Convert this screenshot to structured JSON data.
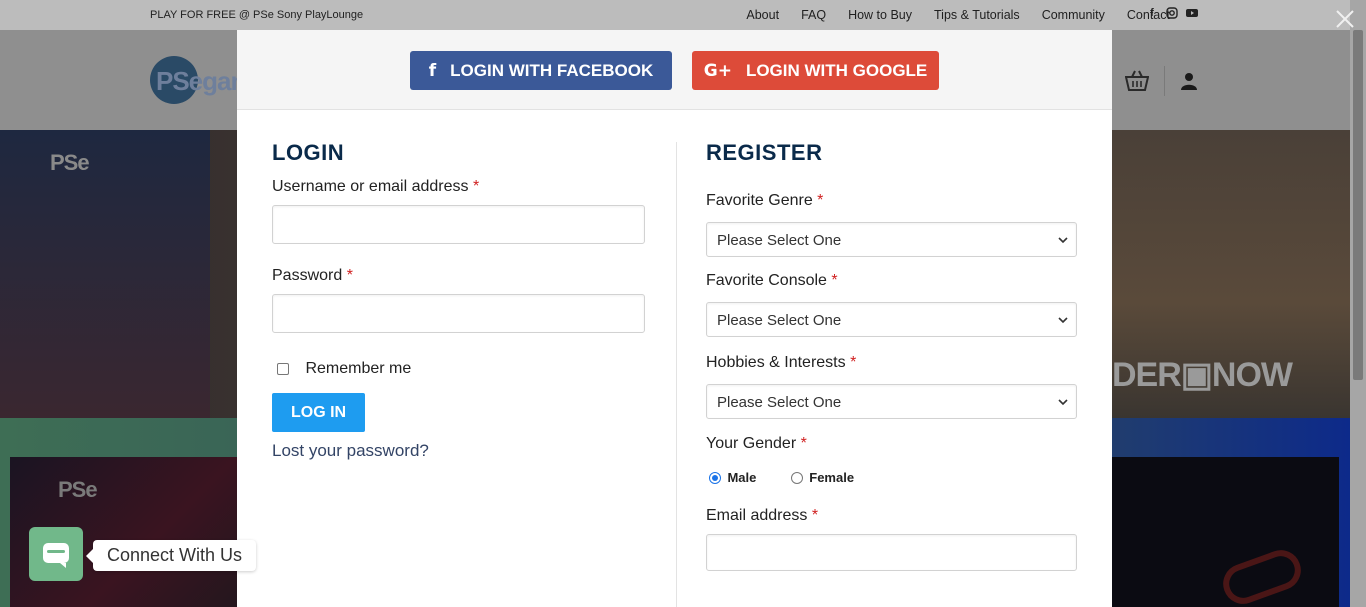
{
  "topbar": {
    "promo": "PLAY FOR FREE @ PSe Sony PlayLounge",
    "nav": [
      "About",
      "FAQ",
      "How to Buy",
      "Tips & Tutorials",
      "Community",
      "Contact"
    ],
    "social_icons": [
      "facebook-icon",
      "instagram-icon",
      "youtube-icon"
    ]
  },
  "header": {
    "logo_text": "PSegam"
  },
  "hero": {
    "left_logo": "PSe",
    "preorder_text": "DER▣NOW",
    "card_logo": "PSe"
  },
  "social_login": {
    "facebook_label": "LOGIN WITH FACEBOOK",
    "google_label": "LOGIN WITH GOOGLE",
    "facebook_color": "#3b5998",
    "google_color": "#dd4b39"
  },
  "login": {
    "title": "LOGIN",
    "username_label": "Username or email address",
    "password_label": "Password",
    "required_mark": "*",
    "remember_label": "Remember me",
    "submit_label": "LOG IN",
    "lost_password": "Lost your password?"
  },
  "register": {
    "title": "REGISTER",
    "genre_label": "Favorite Genre",
    "genre_value": "Please Select One",
    "console_label": "Favorite Console",
    "console_value": "Please Select One",
    "hobbies_label": "Hobbies & Interests",
    "hobbies_value": "Please Select One",
    "gender_label": "Your Gender",
    "gender_options": [
      "Male",
      "Female"
    ],
    "gender_selected": "Male",
    "email_label": "Email address",
    "required_mark": "*"
  },
  "widget": {
    "connect_label": "Connect With Us"
  },
  "colors": {
    "accent": "#1e9cf0",
    "heading": "#0a2a4a",
    "required": "#d02020"
  }
}
